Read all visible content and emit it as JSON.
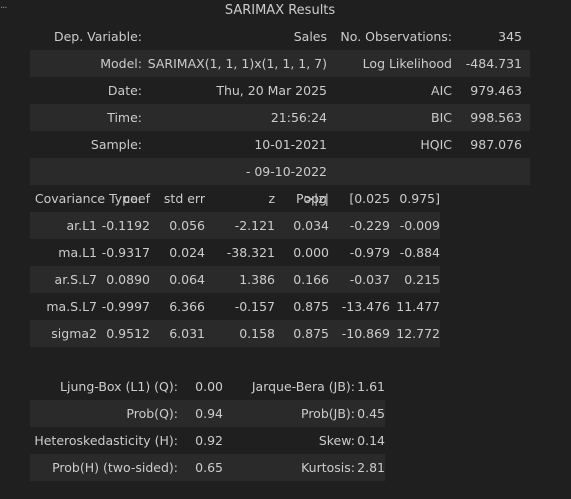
{
  "title": "SARIMAX Results",
  "summary": {
    "dep_variable_label": "Dep. Variable:",
    "dep_variable_value": "Sales",
    "n_obs_label": "No. Observations:",
    "n_obs_value": "345",
    "model_label": "Model:",
    "model_value": "SARIMAX(1, 1, 1)x(1, 1, 1, 7)",
    "loglik_label": "Log Likelihood",
    "loglik_value": "-484.731",
    "date_label": "Date:",
    "date_value": "Thu, 20 Mar 2025",
    "aic_label": "AIC",
    "aic_value": "979.463",
    "time_label": "Time:",
    "time_value": "21:56:24",
    "bic_label": "BIC",
    "bic_value": "998.563",
    "sample_label": "Sample:",
    "sample_value": "10-01-2021",
    "hqic_label": "HQIC",
    "hqic_value": "987.076",
    "sample_end": "- 09-10-2022",
    "cov_label": "Covariance Type:",
    "cov_value": "opg"
  },
  "coef_table": {
    "headers": [
      "coef",
      "std err",
      "z",
      "P>|z|",
      "[0.025",
      "0.975]"
    ],
    "rows": [
      {
        "name": "ar.L1",
        "coef": "-0.1192",
        "std_err": "0.056",
        "z": "-2.121",
        "p": "0.034",
        "lo": "-0.229",
        "hi": "-0.009"
      },
      {
        "name": "ma.L1",
        "coef": "-0.9317",
        "std_err": "0.024",
        "z": "-38.321",
        "p": "0.000",
        "lo": "-0.979",
        "hi": "-0.884"
      },
      {
        "name": "ar.S.L7",
        "coef": "0.0890",
        "std_err": "0.064",
        "z": "1.386",
        "p": "0.166",
        "lo": "-0.037",
        "hi": "0.215"
      },
      {
        "name": "ma.S.L7",
        "coef": "-0.9997",
        "std_err": "6.366",
        "z": "-0.157",
        "p": "0.875",
        "lo": "-13.476",
        "hi": "11.477"
      },
      {
        "name": "sigma2",
        "coef": "0.9512",
        "std_err": "6.031",
        "z": "0.158",
        "p": "0.875",
        "lo": "-10.869",
        "hi": "12.772"
      }
    ]
  },
  "diagnostics": {
    "ljung_label": "Ljung-Box (L1) (Q):",
    "ljung_value": "0.00",
    "jb_label": "Jarque-Bera (JB):",
    "jb_value": "1.61",
    "probq_label": "Prob(Q):",
    "probq_value": "0.94",
    "probjb_label": "Prob(JB):",
    "probjb_value": "0.45",
    "hetero_label": "Heteroskedasticity (H):",
    "hetero_value": "0.92",
    "skew_label": "Skew:",
    "skew_value": "0.14",
    "probh_label": "Prob(H) (two-sided):",
    "probh_value": "0.65",
    "kurt_label": "Kurtosis:",
    "kurt_value": "2.81"
  },
  "colors": {
    "background": "#1f1f1f",
    "stripe": "#2a2a2a",
    "text": "#cccccc"
  },
  "icons": {
    "gutter": "ellipsis-icon"
  }
}
